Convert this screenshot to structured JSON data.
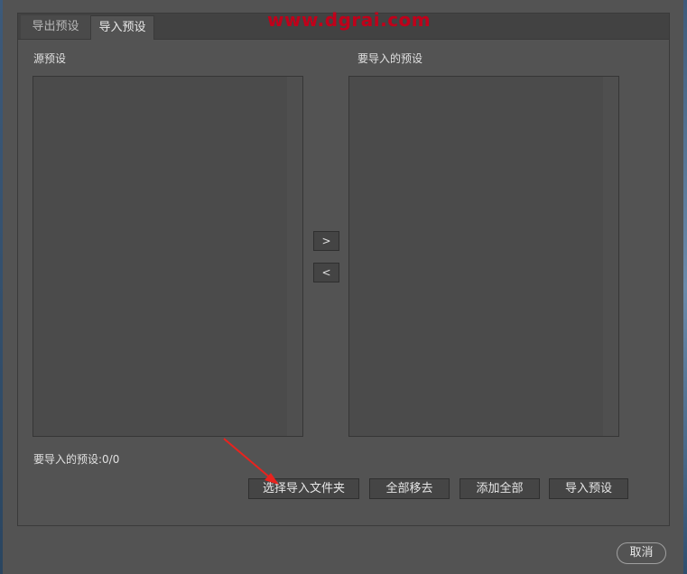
{
  "watermark": "www.dgrai.com",
  "tabs": [
    {
      "label": "导出预设"
    },
    {
      "label": "导入预设"
    }
  ],
  "source_presets": {
    "label": "源预设"
  },
  "target_presets": {
    "label": "要导入的预设"
  },
  "transfer": {
    "add_label": ">",
    "remove_label": "<"
  },
  "status": {
    "text": "要导入的预设:0/0"
  },
  "actions": {
    "choose_folder": "选择导入文件夹",
    "remove_all": "全部移去",
    "add_all": "添加全部",
    "import": "导入预设"
  },
  "footer": {
    "cancel": "取消"
  },
  "colors": {
    "watermark": "#c0001a",
    "annotation_arrow": "#e8231e"
  }
}
